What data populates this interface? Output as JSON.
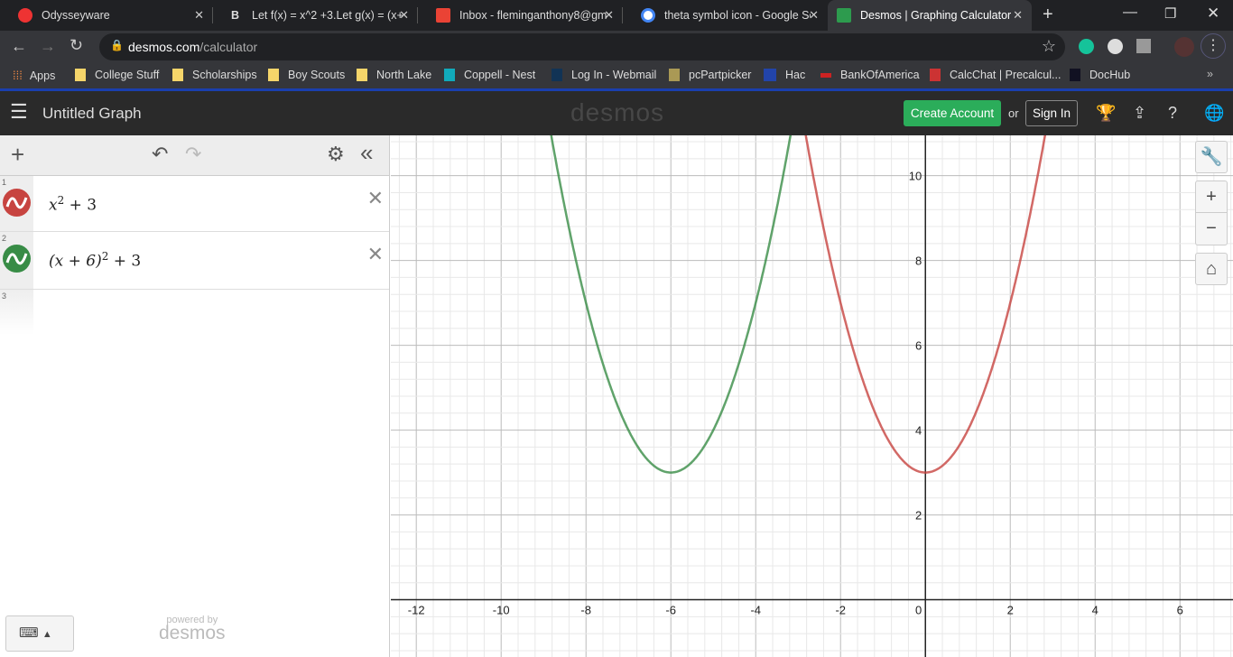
{
  "browser": {
    "tabs": [
      {
        "title": "Odysseyware",
        "color": "#e33"
      },
      {
        "title": "Let f(x) = x^2 +3.Let g(x) = (x+",
        "color": "#fff"
      },
      {
        "title": "Inbox - fleminganthony8@gm",
        "color": "#ea4335"
      },
      {
        "title": "theta symbol icon - Google Se",
        "color": "#4285f4"
      },
      {
        "title": "Desmos | Graphing Calculator",
        "color": "#2d9b4e"
      }
    ],
    "url_host": "desmos.com",
    "url_path": "/calculator",
    "bookmarks": [
      "Apps",
      "College Stuff",
      "Scholarships",
      "Boy Scouts",
      "North Lake",
      "Coppell - Nest",
      "Log In - Webmail",
      "pcPartpicker",
      "Hac",
      "BankOfAmerica",
      "CalcChat | Precalcul...",
      "DocHub"
    ]
  },
  "header": {
    "title": "Untitled Graph",
    "logo": "desmos",
    "create_account": "Create Account",
    "or": "or",
    "sign_in": "Sign In"
  },
  "expressions": [
    {
      "num": "1",
      "latex_base": "x",
      "latex_sup": "2",
      "latex_rest": " + 3",
      "color": "#c74440"
    },
    {
      "num": "2",
      "latex_base": "(x + 6)",
      "latex_sup": "2",
      "latex_rest": " + 3",
      "color": "#388c46"
    },
    {
      "num": "3"
    }
  ],
  "footer": {
    "powered_by": "powered by",
    "brand": "desmos"
  },
  "graph": {
    "xlim": [
      -12.6,
      7.25
    ],
    "ylim": [
      -1.35,
      10.95
    ],
    "x_ticks": [
      "-12",
      "-10",
      "-8",
      "-6",
      "-4",
      "-2",
      "0",
      "2",
      "4",
      "6"
    ],
    "y_ticks": [
      "2",
      "4",
      "6",
      "8",
      "10"
    ],
    "curves": [
      {
        "expr": "x^2+3",
        "h": 0,
        "k": 3,
        "color": "#c74440"
      },
      {
        "expr": "(x+6)^2+3",
        "h": -6,
        "k": 3,
        "color": "#388c46"
      }
    ]
  }
}
